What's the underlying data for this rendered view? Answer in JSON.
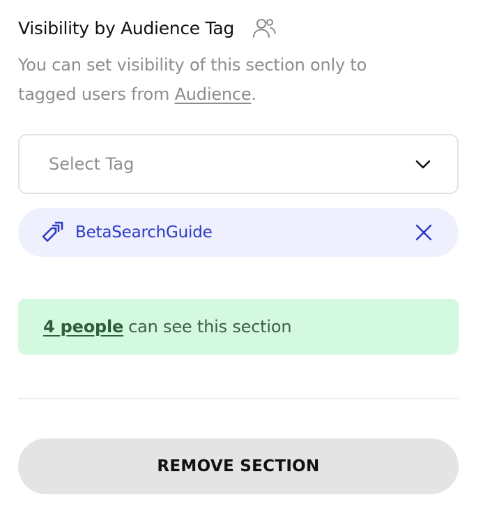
{
  "header": {
    "title": "Visibility by Audience Tag",
    "icon": "users-icon"
  },
  "description": {
    "text_before": "You can set visibility of this section only to tagged users from ",
    "link": "Audience",
    "text_after": "."
  },
  "tag_select": {
    "placeholder": "Select Tag",
    "icon": "chevron-down-icon"
  },
  "selected_tags": [
    {
      "label": "BetaSearchGuide",
      "icon": "tag-icon",
      "remove_icon": "close-icon"
    }
  ],
  "audience": {
    "count_text": "4 people",
    "rest_text": "can see this section"
  },
  "actions": {
    "remove_label": "REMOVE SECTION"
  },
  "colors": {
    "tag_chip_bg": "#eef0fd",
    "tag_text": "#2c3bc6",
    "audience_bg": "#d4f9e1",
    "audience_text": "#3e5e48",
    "remove_button_bg": "#e4e4e4"
  }
}
